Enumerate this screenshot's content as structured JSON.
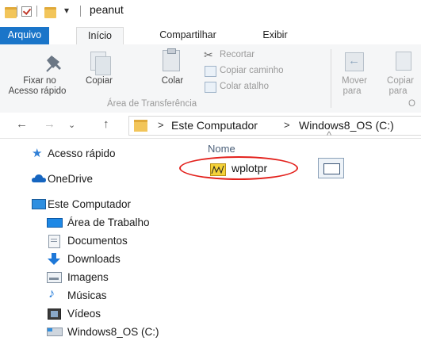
{
  "window": {
    "title": "peanut",
    "quick_access_arrow": "▾"
  },
  "ribbon_tabs": [
    "Arquivo",
    "Início",
    "Compartilhar",
    "Exibir"
  ],
  "ribbon": {
    "pin_label_line1": "Fixar no",
    "pin_label_line2": "Acesso rápido",
    "copy_label": "Copiar",
    "paste_label": "Colar",
    "cut_label": "Recortar",
    "copy_path_label": "Copiar caminho",
    "paste_shortcut_label": "Colar atalho",
    "group_clipboard": "Área de Transferência",
    "move_to_line1": "Mover",
    "move_to_line2": "para",
    "copy_to_line1": "Copiar",
    "copy_to_line2": "para",
    "group_organize_partial": "O"
  },
  "address": {
    "crumbs": [
      "Este Computador",
      "Windows8_OS (C:)"
    ],
    "separator": ">"
  },
  "nav_pane": {
    "items": [
      {
        "label": "Acesso rápido",
        "icon": "star-icon"
      },
      {
        "label": "OneDrive",
        "icon": "cloud-icon"
      },
      {
        "label": "Este Computador",
        "icon": "computer-icon"
      },
      {
        "label": "Área de Trabalho",
        "icon": "desktop-icon"
      },
      {
        "label": "Documentos",
        "icon": "documents-icon"
      },
      {
        "label": "Downloads",
        "icon": "download-icon"
      },
      {
        "label": "Imagens",
        "icon": "images-icon"
      },
      {
        "label": "Músicas",
        "icon": "music-icon"
      },
      {
        "label": "Vídeos",
        "icon": "videos-icon"
      },
      {
        "label": "Windows8_OS (C:)",
        "icon": "drive-icon"
      }
    ]
  },
  "content": {
    "column_header": "Nome",
    "files": [
      {
        "name": "wplotpr",
        "highlighted": true
      }
    ]
  },
  "colors": {
    "file_tab": "#1a75c9",
    "highlight_ellipse": "#e3211c",
    "folder": "#f2c55a"
  }
}
